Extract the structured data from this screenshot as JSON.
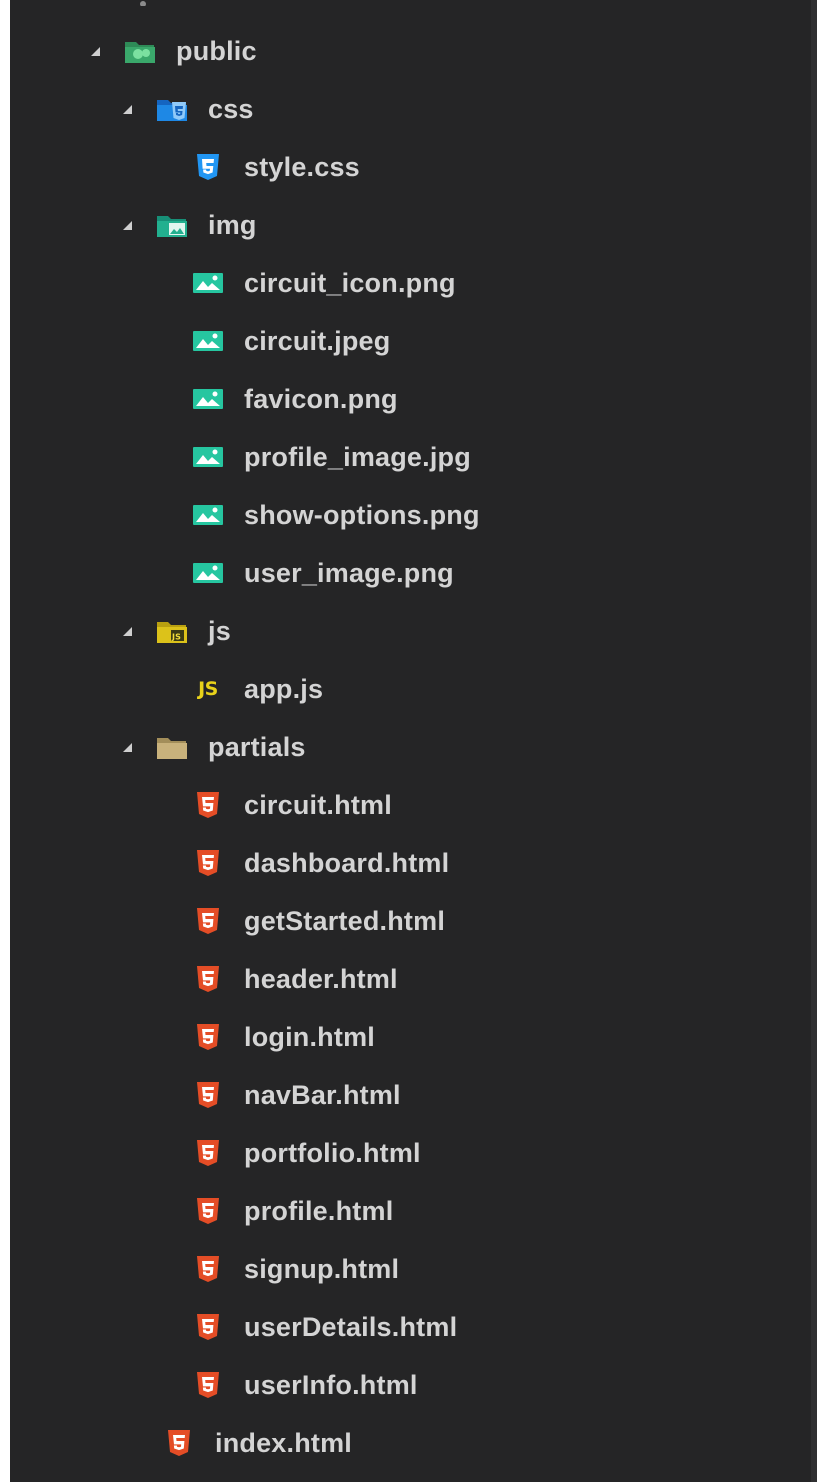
{
  "explorer": {
    "items": [
      {
        "label": "public",
        "type": "folder",
        "icon": "folder-public-icon",
        "expanded": true
      },
      {
        "label": "css",
        "type": "folder",
        "icon": "folder-css-icon",
        "expanded": true
      },
      {
        "label": "style.css",
        "type": "file",
        "icon": "css3-file-icon"
      },
      {
        "label": "img",
        "type": "folder",
        "icon": "folder-images-icon",
        "expanded": true
      },
      {
        "label": "circuit_icon.png",
        "type": "file",
        "icon": "image-file-icon"
      },
      {
        "label": "circuit.jpeg",
        "type": "file",
        "icon": "image-file-icon"
      },
      {
        "label": "favicon.png",
        "type": "file",
        "icon": "image-file-icon"
      },
      {
        "label": "profile_image.jpg",
        "type": "file",
        "icon": "image-file-icon"
      },
      {
        "label": "show-options.png",
        "type": "file",
        "icon": "image-file-icon"
      },
      {
        "label": "user_image.png",
        "type": "file",
        "icon": "image-file-icon"
      },
      {
        "label": "js",
        "type": "folder",
        "icon": "folder-js-icon",
        "expanded": true
      },
      {
        "label": "app.js",
        "type": "file",
        "icon": "js-file-icon",
        "glyph": "JS"
      },
      {
        "label": "partials",
        "type": "folder",
        "icon": "folder-icon",
        "expanded": true
      },
      {
        "label": "circuit.html",
        "type": "file",
        "icon": "html5-file-icon"
      },
      {
        "label": "dashboard.html",
        "type": "file",
        "icon": "html5-file-icon"
      },
      {
        "label": "getStarted.html",
        "type": "file",
        "icon": "html5-file-icon"
      },
      {
        "label": "header.html",
        "type": "file",
        "icon": "html5-file-icon"
      },
      {
        "label": "login.html",
        "type": "file",
        "icon": "html5-file-icon"
      },
      {
        "label": "navBar.html",
        "type": "file",
        "icon": "html5-file-icon"
      },
      {
        "label": "portfolio.html",
        "type": "file",
        "icon": "html5-file-icon"
      },
      {
        "label": "profile.html",
        "type": "file",
        "icon": "html5-file-icon"
      },
      {
        "label": "signup.html",
        "type": "file",
        "icon": "html5-file-icon"
      },
      {
        "label": "userDetails.html",
        "type": "file",
        "icon": "html5-file-icon"
      },
      {
        "label": "userInfo.html",
        "type": "file",
        "icon": "html5-file-icon"
      },
      {
        "label": "index.html",
        "type": "file",
        "icon": "html5-file-icon"
      }
    ]
  },
  "colors": {
    "background": "#252526",
    "text": "#d4d4d4",
    "html5": "#e44d26",
    "css3": "#2196f3",
    "image": "#26c6a0",
    "js": "#e8d21a",
    "folder": "#c9b27c"
  }
}
